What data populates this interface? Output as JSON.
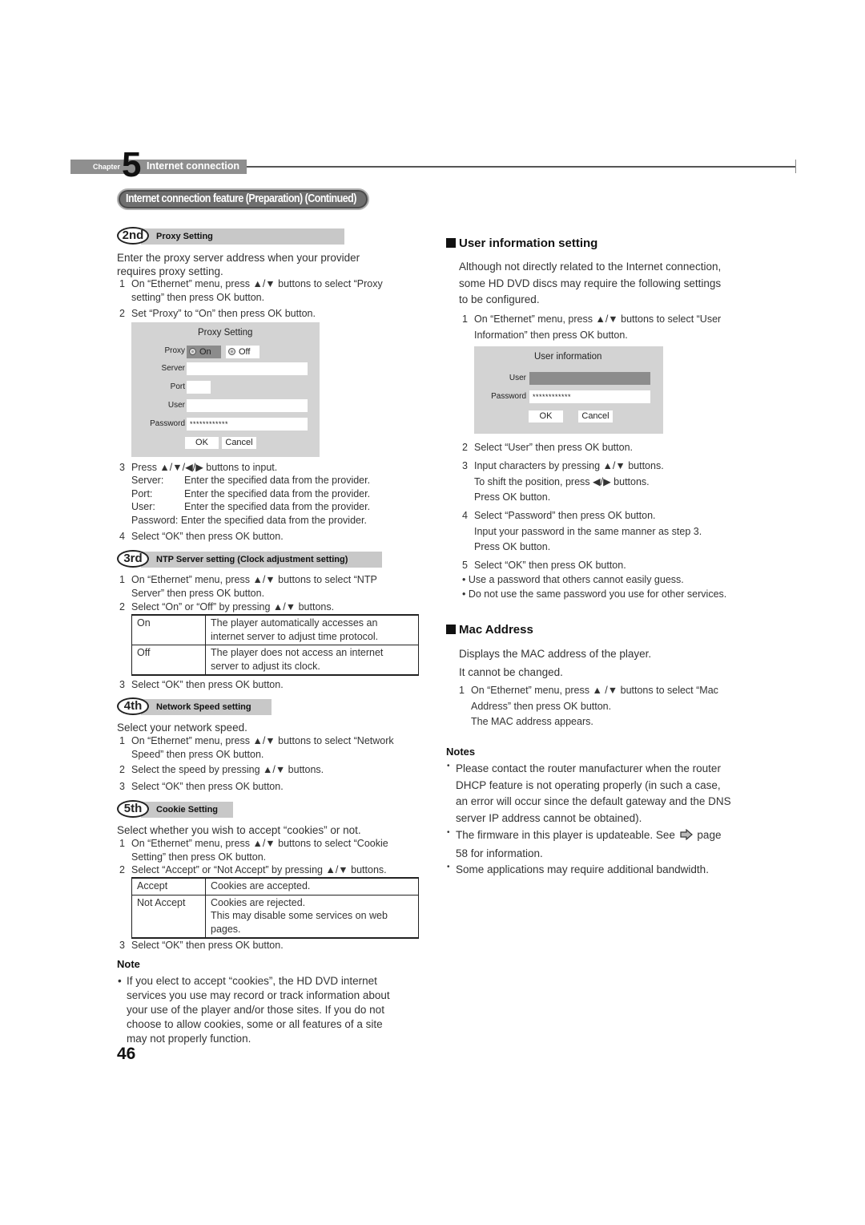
{
  "chapter": {
    "word": "Chapter",
    "number": "5",
    "title": "Internet connection"
  },
  "section_title": "Internet connection feature (Preparation) (Continued)",
  "left": {
    "proxy": {
      "step": "2nd",
      "label": "Proxy Setting",
      "intro": [
        "Enter the proxy server address when your provider",
        "requires proxy setting."
      ],
      "steps": [
        {
          "n": "1",
          "lines": [
            "On “Ethernet” menu, press ▲/▼ buttons to select “Proxy",
            "setting” then press OK button."
          ]
        },
        {
          "n": "2",
          "lines": [
            "Set “Proxy” to “On” then press OK button."
          ]
        }
      ],
      "dialog": {
        "title": "Proxy Setting",
        "proxy_label": "Proxy",
        "on_label": "On",
        "off_label": "Off",
        "server_label": "Server",
        "port_label": "Port",
        "user_label": "User",
        "password_label": "Password",
        "server_value": "",
        "port_value": "",
        "user_value": "",
        "password_value": "************",
        "ok": "OK",
        "cancel": "Cancel"
      },
      "step3": {
        "n": "3",
        "text": "Press ▲/▼/◀/▶ buttons to input."
      },
      "fields_help": [
        {
          "k": "Server:",
          "v": "Enter the specified data from the provider."
        },
        {
          "k": "Port:",
          "v": "Enter the specified data from the provider."
        },
        {
          "k": "User:",
          "v": "Enter the specified data from the provider."
        },
        {
          "k": "Password:",
          "v": "Enter the specified data from the provider."
        }
      ],
      "step4": {
        "n": "4",
        "text": "Select “OK” then press OK button."
      }
    },
    "ntp": {
      "step": "3rd",
      "label": "NTP Server setting (Clock adjustment setting)",
      "steps": [
        {
          "n": "1",
          "lines": [
            "On “Ethernet” menu, press ▲/▼ buttons to select “NTP",
            "Server” then press OK button."
          ]
        },
        {
          "n": "2",
          "lines": [
            "Select “On” or “Off” by pressing ▲/▼ buttons."
          ]
        }
      ],
      "table": [
        {
          "opt": "On",
          "desc": [
            "The player automatically accesses an",
            "internet server to adjust time protocol."
          ]
        },
        {
          "opt": "Off",
          "desc": [
            "The player does not access an internet",
            "server to adjust its clock."
          ]
        }
      ],
      "step3": {
        "n": "3",
        "text": "Select “OK” then press OK button."
      }
    },
    "speed": {
      "step": "4th",
      "label": "Network Speed setting",
      "intro": "Select your network speed.",
      "steps": [
        {
          "n": "1",
          "lines": [
            "On “Ethernet” menu, press ▲/▼ buttons to select “Network",
            "Speed” then press OK button."
          ]
        },
        {
          "n": "2",
          "lines": [
            "Select the speed by pressing ▲/▼ buttons."
          ]
        },
        {
          "n": "3",
          "lines": [
            "Select “OK” then press OK button."
          ]
        }
      ]
    },
    "cookie": {
      "step": "5th",
      "label": "Cookie Setting",
      "intro": "Select whether you wish to accept “cookies” or not.",
      "steps": [
        {
          "n": "1",
          "lines": [
            "On “Ethernet” menu, press ▲/▼ buttons to select “Cookie",
            "Setting” then press OK button."
          ]
        },
        {
          "n": "2",
          "lines": [
            "Select “Accept” or “Not Accept” by pressing ▲/▼ buttons."
          ]
        }
      ],
      "table": [
        {
          "opt": "Accept",
          "desc": [
            "Cookies are accepted."
          ]
        },
        {
          "opt": "Not Accept",
          "desc": [
            "Cookies are rejected.",
            "This may disable some services on web",
            "pages."
          ]
        }
      ],
      "step3": {
        "n": "3",
        "text": "Select “OK” then press OK button."
      }
    },
    "note": {
      "heading": "Note",
      "bullet": "•",
      "lines": [
        "If you elect to accept “cookies”, the HD DVD internet",
        "services you use may record or track information about",
        "your use of the player and/or those sites.  If you do not",
        "choose to allow cookies, some or all features of a site",
        "may not properly function."
      ]
    }
  },
  "right": {
    "user_info": {
      "heading": "User information setting",
      "intro": [
        "Although not directly related to the Internet connection,",
        "some HD DVD discs may require the following settings",
        "to be configured."
      ],
      "step1": {
        "n": "1",
        "lines": [
          "On “Ethernet” menu, press ▲/▼ buttons to select “User",
          "Information” then press OK button."
        ]
      },
      "dialog": {
        "title": "User information",
        "user_label": "User",
        "password_label": "Password",
        "user_value": "",
        "password_value": "************",
        "ok": "OK",
        "cancel": "Cancel"
      },
      "steps": [
        {
          "n": "2",
          "lines": [
            "Select “User” then press OK button."
          ]
        },
        {
          "n": "3",
          "lines": [
            "Input characters by pressing ▲/▼ buttons.",
            "To shift the position, press ◀/▶ buttons.",
            "Press OK button."
          ]
        },
        {
          "n": "4",
          "lines": [
            "Select “Password” then press OK button.",
            "Input your password in the same manner as step 3.",
            "Press OK button."
          ]
        },
        {
          "n": "5",
          "lines": [
            "Select “OK” then press OK button."
          ]
        }
      ],
      "bullets": [
        "Use a password that others cannot easily guess.",
        "Do not use the same password you use for other services."
      ]
    },
    "mac": {
      "heading": "Mac Address",
      "intro": [
        "Displays the MAC address of the player.",
        "It cannot be changed."
      ],
      "step1": {
        "n": "1",
        "lines": [
          "On “Ethernet” menu, press ▲ /▼ buttons to select “Mac",
          "Address” then press OK button.",
          "The MAC address appears."
        ]
      }
    },
    "notes": {
      "heading": "Notes",
      "items": [
        [
          "Please contact the router manufacturer when the router",
          "DHCP feature is not operating properly (in such a case,",
          "an error will occur since the default gateway and the DNS",
          "server IP address cannot be obtained)."
        ],
        [
          "The firmware in this player is updateable. See",
          "58 for information."
        ],
        [
          "Some applications may require additional bandwidth."
        ]
      ],
      "see_page_word": "page"
    }
  },
  "page_number": "46"
}
